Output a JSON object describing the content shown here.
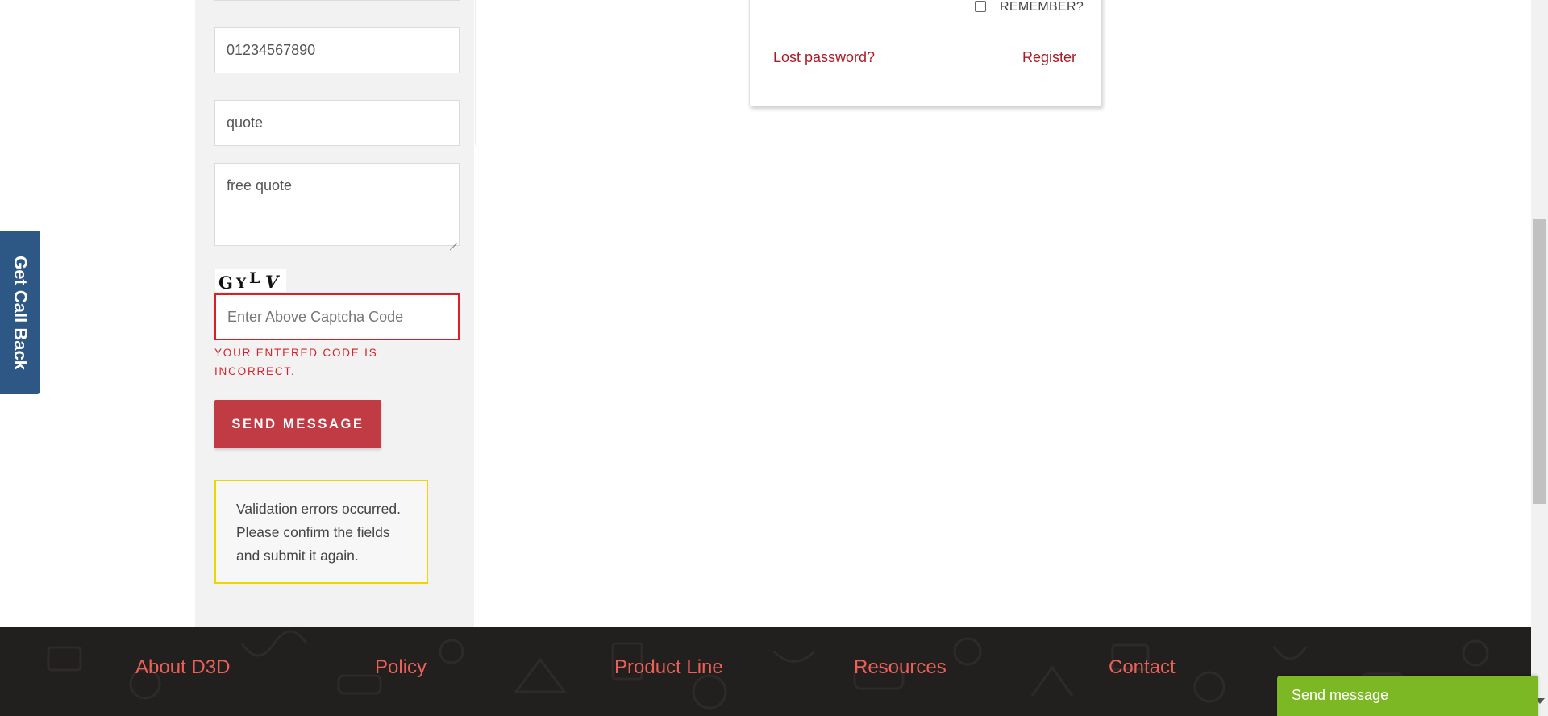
{
  "form": {
    "phone_value": "01234567890",
    "subject_value": "quote",
    "message_value": "free quote",
    "captcha_chars": [
      "G",
      "Y",
      "L",
      "V"
    ],
    "captcha_placeholder": "Enter Above Captcha Code",
    "captcha_error": "YOUR ENTERED CODE IS INCORRECT.",
    "send_label": "SEND MESSAGE",
    "validation_message": "Validation errors occurred. Please confirm the fields and submit it again."
  },
  "login": {
    "remember_label": "REMEMBER?",
    "lost_password": "Lost password?",
    "register": "Register"
  },
  "side_tab": {
    "label": "Get Call Back"
  },
  "footer": {
    "headings": [
      "About D3D",
      "Policy",
      "Product Line",
      "Resources",
      "Contact"
    ]
  },
  "chat_widget": {
    "label": "Send message"
  },
  "colors": {
    "accent_red": "#c13b45",
    "error_red": "#dc1f26",
    "footer_heading": "#ee5f57",
    "footer_bg": "#221f1f",
    "chat_green": "#7cb823",
    "callback_blue": "#2d5784",
    "validation_border": "#f0d600"
  }
}
